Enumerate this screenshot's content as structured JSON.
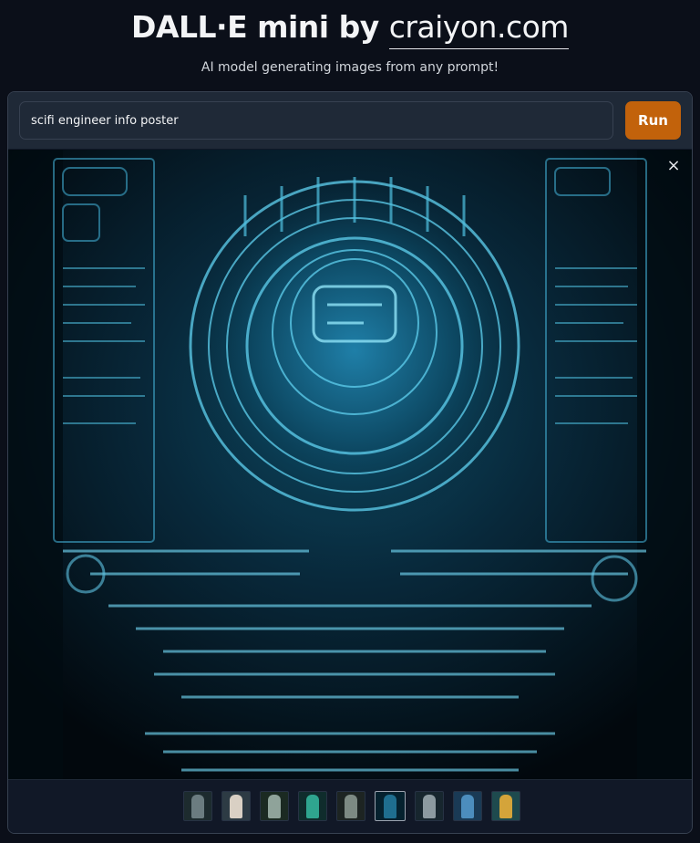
{
  "header": {
    "title_main": "DALL·E mini by ",
    "title_link": "craiyon.com",
    "subtitle": "AI model generating images from any prompt!"
  },
  "prompt": {
    "value": "scifi engineer info poster",
    "placeholder": ""
  },
  "run_button": {
    "label": "Run"
  },
  "main_image": {
    "close_label": "×",
    "description_icon": "scifi-poster-image"
  },
  "thumbnails": [
    {
      "name": "thumbnail-1",
      "bg": "#1d2b2e",
      "fig": "#6b7c80"
    },
    {
      "name": "thumbnail-2",
      "bg": "#2d3b44",
      "fig": "#d9d0c4"
    },
    {
      "name": "thumbnail-3",
      "bg": "#1b2a22",
      "fig": "#8fa39a"
    },
    {
      "name": "thumbnail-4",
      "bg": "#0f2c2c",
      "fig": "#2fa58f"
    },
    {
      "name": "thumbnail-5",
      "bg": "#1d2422",
      "fig": "#7d8a83"
    },
    {
      "name": "thumbnail-6",
      "bg": "#05212e",
      "fig": "#1f6e8f",
      "selected": true
    },
    {
      "name": "thumbnail-7",
      "bg": "#17262e",
      "fig": "#8c9aa0"
    },
    {
      "name": "thumbnail-8",
      "bg": "#1a3a55",
      "fig": "#4c8dbd"
    },
    {
      "name": "thumbnail-9",
      "bg": "#1e4a4e",
      "fig": "#d4a43a"
    }
  ],
  "colors": {
    "background": "#0b0f19",
    "panel": "#111827",
    "run_button": "#c2620b",
    "image_glow": "#3fb3d6"
  }
}
